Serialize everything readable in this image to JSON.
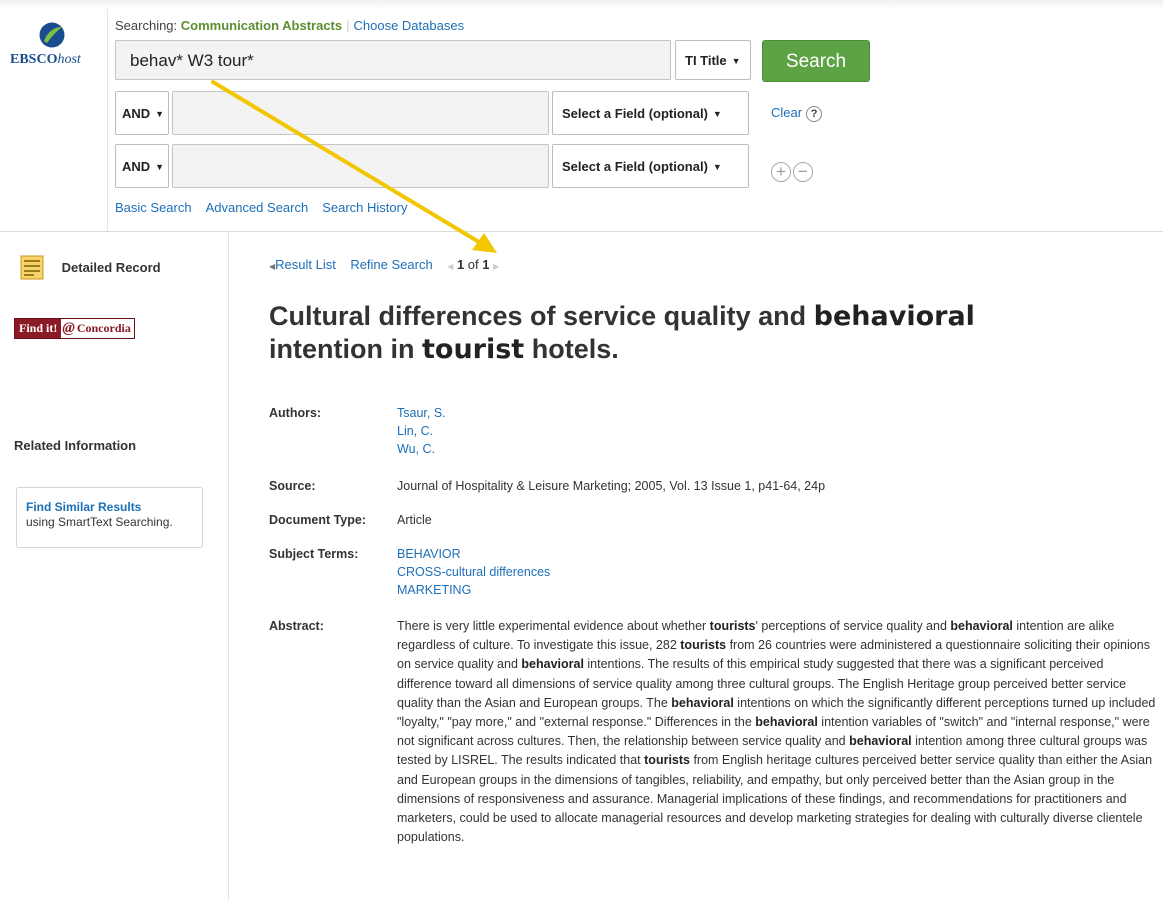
{
  "header": {
    "logo_text_bold": "EBSCO",
    "logo_text_italic": "host",
    "searching_label": "Searching:",
    "database_name": "Communication Abstracts",
    "choose_databases": "Choose Databases",
    "query_1": "behav* W3 tour*",
    "field_1": "TI Title",
    "search_button": "Search",
    "operator_2": "AND",
    "operator_3": "AND",
    "field_2": "Select a Field (optional)",
    "field_3": "Select a Field (optional)",
    "clear_label": "Clear",
    "help_icon": "?",
    "add_row_icon": "+",
    "remove_row_icon": "−",
    "links": [
      "Basic Search",
      "Advanced Search",
      "Search History"
    ]
  },
  "sidebar": {
    "detailed_record": "Detailed Record",
    "findit_a": "Find it!",
    "findit_at": "@",
    "findit_b": "Concordia",
    "related_information": "Related Information",
    "find_similar_title": "Find Similar Results",
    "find_similar_sub": "using SmartText Searching."
  },
  "record": {
    "nav_result_list": "Result List",
    "nav_refine_search": "Refine Search",
    "nav_position": "1",
    "nav_of": "of",
    "nav_total": "1",
    "title_a": "Cultural differences of service quality and ",
    "title_hl1": "behavioral",
    "title_b": "intention in ",
    "title_hl2": "tourist",
    "title_c": " hotels.",
    "authors_label": "Authors:",
    "authors": [
      "Tsaur, S.",
      "Lin, C.",
      "Wu, C."
    ],
    "source_label": "Source:",
    "source": "Journal of Hospitality & Leisure Marketing; 2005, Vol. 13 Issue 1, p41-64, 24p",
    "doctype_label": "Document Type:",
    "doctype": "Article",
    "subjects_label": "Subject Terms:",
    "subjects": [
      "BEHAVIOR",
      "CROSS-cultural differences",
      "MARKETING"
    ],
    "abstract_label": "Abstract:",
    "abstract_parts": [
      [
        "There is very little experimental evidence about whether ",
        false
      ],
      [
        "tourists",
        true
      ],
      [
        "' perceptions of service quality and ",
        false
      ],
      [
        "behavioral",
        true
      ],
      [
        " intention are alike regardless of culture. To investigate this issue, 282 ",
        false
      ],
      [
        "tourists",
        true
      ],
      [
        " from 26 countries were administered a questionnaire soliciting their opinions on service quality and ",
        false
      ],
      [
        "behavioral",
        true
      ],
      [
        " intentions. The results of this empirical study suggested that there was a significant perceived difference toward all dimensions of service quality among three cultural groups. The English Heritage group perceived better service quality than the Asian and European groups. The ",
        false
      ],
      [
        "behavioral",
        true
      ],
      [
        " intentions on which the significantly different perceptions turned up included \"loyalty,\" \"pay more,\" and \"external response.\" Differences in the ",
        false
      ],
      [
        "behavioral",
        true
      ],
      [
        " intention variables of \"switch\" and \"internal response,\" were not significant across cultures. Then, the relationship between service quality and ",
        false
      ],
      [
        "behavioral",
        true
      ],
      [
        " intention among three cultural groups was tested by LISREL. The results indicated that ",
        false
      ],
      [
        "tourists",
        true
      ],
      [
        " from English heritage cultures perceived better service quality than either the Asian and European groups in the dimensions of tangibles, reliability, and empathy, but only perceived better than the Asian group in the dimensions of responsiveness and assurance. Managerial implications of these findings, and recommendations for practitioners and marketers, could be used to allocate managerial resources and develop marketing strategies for dealing with culturally diverse clientele populations.",
        false
      ]
    ]
  },
  "colors": {
    "link": "#1d6fb8",
    "search_button": "#5da245",
    "database_name": "#5c8e2f",
    "annotation_arrow": "#f2c600",
    "findit": "#8a1a25"
  },
  "icons": {
    "logo": "ebsco-leaf-icon",
    "detailed_record": "document-icon",
    "dropdown": "caret-down-icon",
    "nav_prev": "triangle-left-icon",
    "nav_next": "triangle-right-icon"
  }
}
